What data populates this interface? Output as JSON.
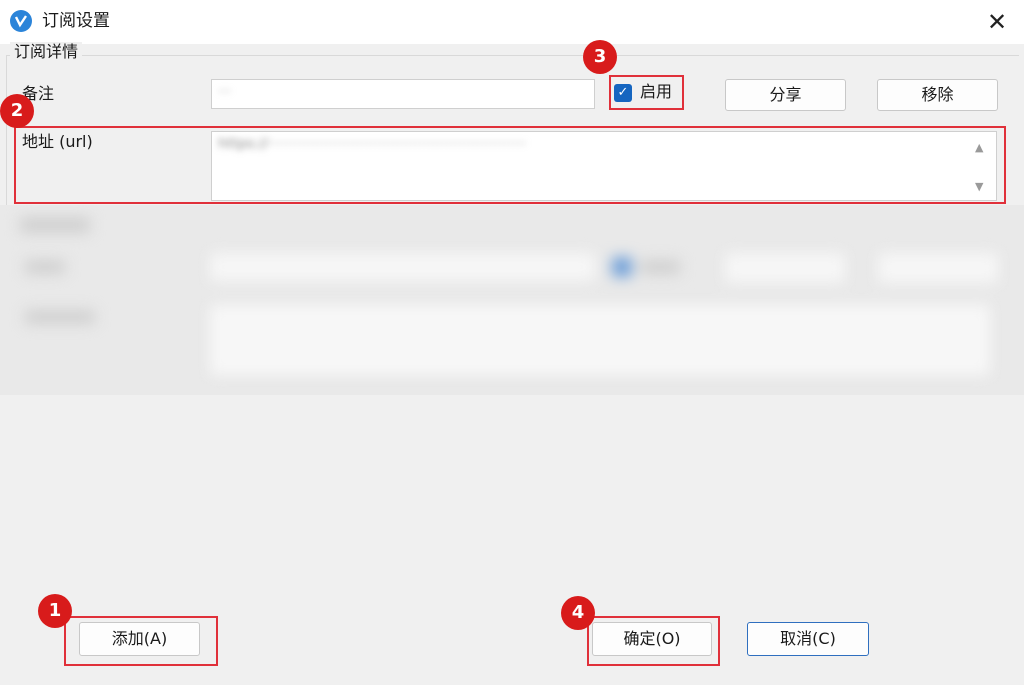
{
  "window": {
    "title": "订阅设置",
    "close_glyph": "✕"
  },
  "group": {
    "title": "订阅详情"
  },
  "remark": {
    "label": "备注",
    "value": "···"
  },
  "enable": {
    "label": "启用",
    "checked": true,
    "check_glyph": "✓"
  },
  "buttons": {
    "share": "分享",
    "remove": "移除",
    "add": "添加(A)",
    "ok": "确定(O)",
    "cancel": "取消(C)"
  },
  "url": {
    "label": "地址 (url)",
    "value": "https://··························································"
  },
  "scroll": {
    "up_glyph": "▲",
    "down_glyph": "▼"
  },
  "markers": [
    "1",
    "2",
    "3",
    "4"
  ],
  "colors": {
    "marker": "#d81b1b",
    "checkbox": "#1565c0",
    "app_icon": "#2b84d9"
  }
}
